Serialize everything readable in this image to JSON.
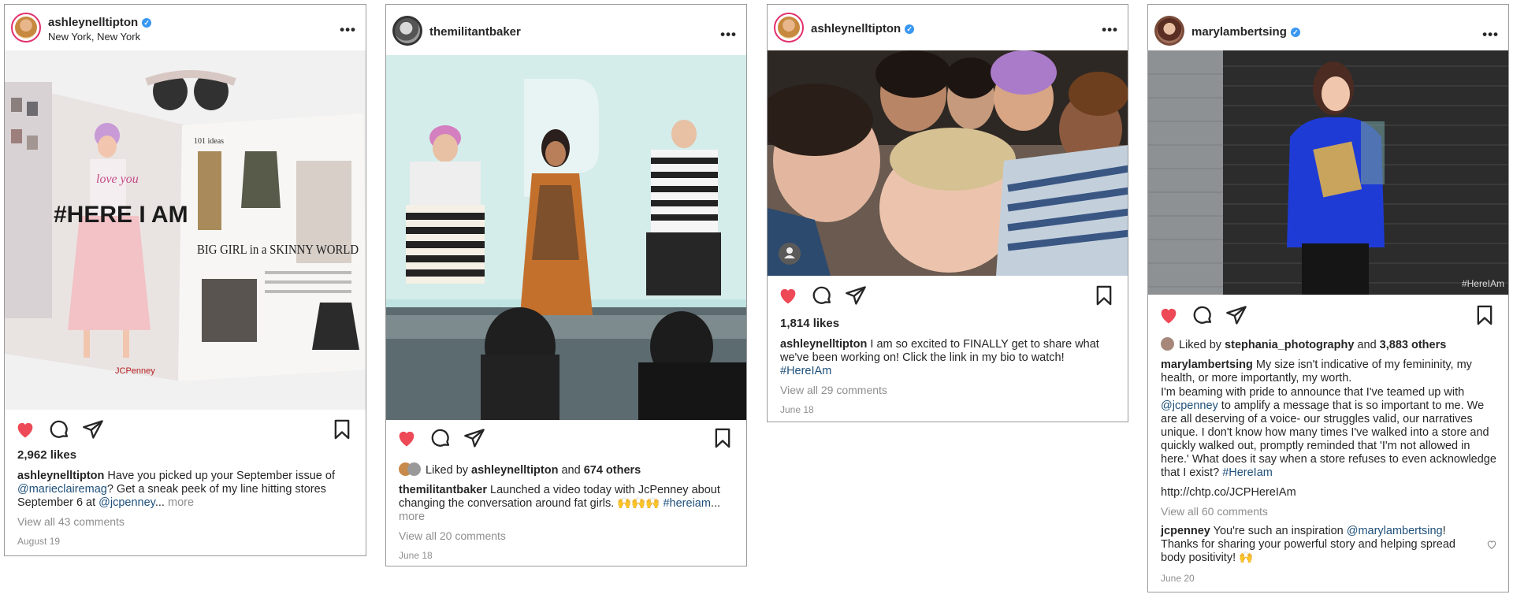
{
  "colors": {
    "heart": "#ed4956",
    "link": "#1e4f7a",
    "verified": "#3897f0"
  },
  "posts": [
    {
      "username": "ashleynelltipton",
      "verified": true,
      "location": "New York, New York",
      "photo_texts": {
        "headline": "#HERE I AM",
        "subhead": "BIG GIRL in a SKINNY WORLD",
        "ideas": "101 ideas",
        "brand": "JCPenney",
        "sticker": "love you"
      },
      "likes": "2,962 likes",
      "caption_user": "ashleynelltipton",
      "caption_parts": [
        "Have you picked up your September issue of ",
        "@marieclairemag",
        "? Get a sneak peek of my line hitting stores September 6 at ",
        "@jcpenney",
        "... ",
        "more"
      ],
      "comments": "View all 43 comments",
      "date": "August 19"
    },
    {
      "username": "themilitantbaker",
      "verified": false,
      "liked_by_prefix": "Liked by ",
      "liked_by_user": "ashleynelltipton",
      "liked_by_and": " and ",
      "liked_by_others": "674 others",
      "caption_user": "themilitantbaker",
      "caption_parts": [
        "Launched a video today with JcPenney about changing the conversation around fat girls. 🙌🙌🙌 ",
        "#hereiam",
        "... ",
        "more"
      ],
      "comments": "View all 20 comments",
      "date": "June 18"
    },
    {
      "username": "ashleynelltipton",
      "verified": true,
      "likes": "1,814 likes",
      "caption_user": "ashleynelltipton",
      "caption_parts": [
        "I am so excited to FINALLY get to share what we've been working on! Click the link in my bio to watch! ",
        "#HereIAm"
      ],
      "comments": "View all 29 comments",
      "date": "June 18"
    },
    {
      "username": "marylambertsing",
      "verified": true,
      "photo_watermark": "#HereIAm",
      "liked_by_prefix": "Liked by ",
      "liked_by_user": "stephania_photography",
      "liked_by_and": " and ",
      "liked_by_others": "3,883 others",
      "caption_user": "marylambertsing",
      "caption_line1": "My size isn't indicative of my femininity, my health, or more importantly, my worth.",
      "caption_p2": [
        "I'm beaming with pride to announce that I've teamed up with ",
        "@jcpenney",
        " to amplify a message that is so important to me. We are all deserving of a voice- our struggles valid, our narratives unique. I don't know how many times I've walked into a store and quickly walked out, promptly reminded that 'I'm not allowed in here.' What does it say when a store refuses to even acknowledge that I exist?  ",
        "#HereIam"
      ],
      "caption_url": "http://chtp.co/JCPHereIAm",
      "comments": "View all 60 comments",
      "comment_user": "jcpenney",
      "comment_parts": [
        "You're such an inspiration ",
        "@marylambertsing",
        "! Thanks for sharing your powerful story and helping spread body positivity! 🙌"
      ],
      "date": "June 20"
    }
  ]
}
